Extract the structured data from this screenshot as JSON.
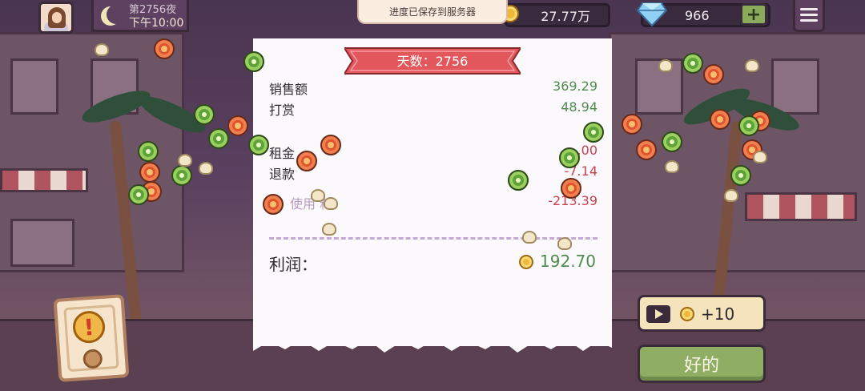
{
  "hud": {
    "day_label": "第2756夜",
    "time_label": "下午10:00",
    "save_toast": "进度已保存到服务器",
    "coins": "27.77万",
    "gems": "966",
    "gem_plus": "+"
  },
  "receipt": {
    "title": "天数：2756",
    "rows": [
      {
        "label": "销售额",
        "value": "369.29"
      },
      {
        "label": "打赏",
        "value": "48.94"
      },
      {
        "label": "租金",
        "value": "-.00"
      },
      {
        "label": "退款",
        "value": "-7.14"
      },
      {
        "label": "使用  料：",
        "value": "-213.39"
      }
    ],
    "profit_label": "利润：",
    "profit_value": "192.70"
  },
  "buttons": {
    "ad_reward": "+10",
    "ok": "好的"
  },
  "colors": {
    "positive": "#4f8a4f",
    "negative": "#c94050",
    "ribbon": "#e2575c",
    "ok_button": "#8fae64"
  }
}
